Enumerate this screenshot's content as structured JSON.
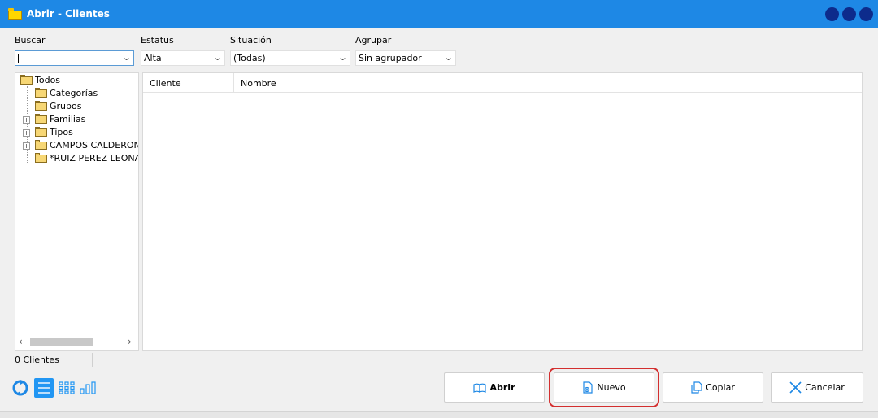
{
  "window": {
    "title": "Abrir - Clientes"
  },
  "filters": {
    "buscar": {
      "label": "Buscar",
      "value": ""
    },
    "estatus": {
      "label": "Estatus",
      "value": "Alta"
    },
    "situacion": {
      "label": "Situación",
      "value": "(Todas)"
    },
    "agrupar": {
      "label": "Agrupar",
      "value": "Sin agrupador"
    }
  },
  "tree": {
    "root": "Todos",
    "items": [
      "Categorías",
      "Grupos",
      "Familias",
      "Tipos",
      "CAMPOS CALDERON",
      "*RUIZ PEREZ LEONA"
    ]
  },
  "grid": {
    "columns": [
      "Cliente",
      "Nombre"
    ]
  },
  "status": {
    "count": "0 Clientes"
  },
  "buttons": {
    "abrir": "Abrir",
    "nuevo": "Nuevo",
    "copiar": "Copiar",
    "cancelar": "Cancelar"
  },
  "colors": {
    "titlebar": "#1e88e5",
    "accent": "#2196f3",
    "highlight": "#d32f2f"
  }
}
